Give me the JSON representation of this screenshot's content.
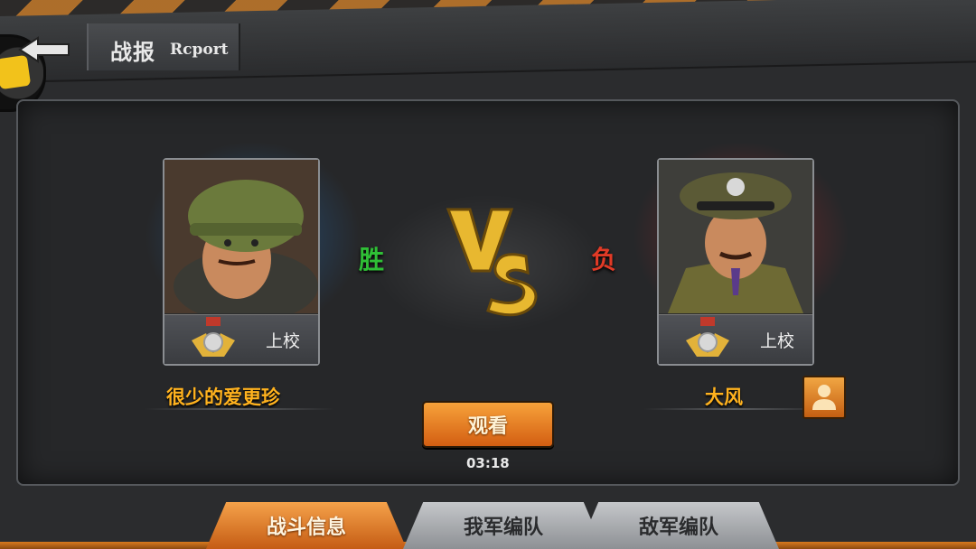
{
  "header": {
    "title": "战报",
    "subtitle": "Rcport"
  },
  "left_player": {
    "name": "很少的爱更珍",
    "rank": "上校",
    "result": "胜"
  },
  "right_player": {
    "name": "大风",
    "rank": "上校",
    "result": "负"
  },
  "center": {
    "watch_label": "观看",
    "time": "03:18"
  },
  "tabs": [
    {
      "label": "战斗信息",
      "active": true
    },
    {
      "label": "我军编队",
      "active": false
    },
    {
      "label": "敌军编队",
      "active": false
    }
  ],
  "colors": {
    "accent": "#f09a2c",
    "win": "#2fbf36",
    "lose": "#e23a26",
    "name": "#ffb21e"
  }
}
